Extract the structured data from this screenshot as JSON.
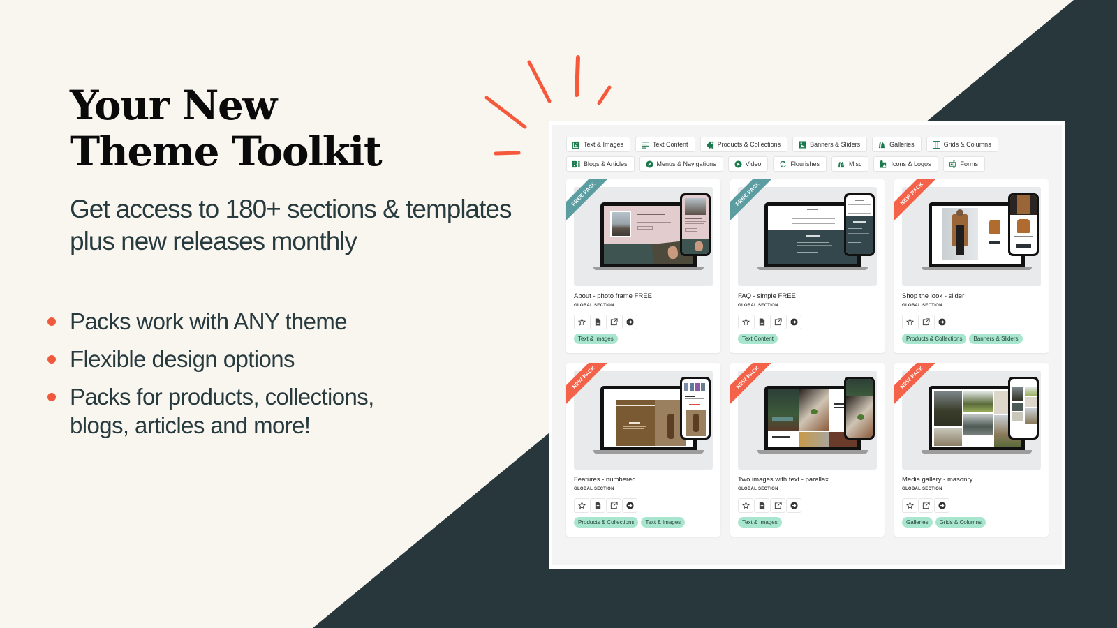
{
  "colors": {
    "background": "#f9f5ef",
    "dark": "#27373b",
    "accent": "#f05a3c",
    "brand_green": "#1b7a4c",
    "tag_bg": "#a9e6cf",
    "free_ribbon": "#5b9da0",
    "new_ribbon": "#f5624a"
  },
  "hero": {
    "title_line1": "Your New",
    "title_line2": "Theme Toolkit",
    "subtitle": "Get access to 180+ sections & templates plus new releases monthly"
  },
  "bullets": [
    "Packs work with ANY theme",
    "Flexible design options",
    "Packs for products, collections, blogs, articles and more!"
  ],
  "filters": {
    "row1": [
      {
        "label": "Text & Images",
        "icon": "image-icon"
      },
      {
        "label": "Text Content",
        "icon": "text-lines-icon"
      },
      {
        "label": "Products & Collections",
        "icon": "tag-plus-icon"
      },
      {
        "label": "Banners & Sliders",
        "icon": "picture-icon"
      },
      {
        "label": "Galleries",
        "icon": "bags-icon"
      },
      {
        "label": "Grids & Columns",
        "icon": "columns-icon"
      }
    ],
    "row2": [
      {
        "label": "Blogs & Articles",
        "icon": "blog-icon"
      },
      {
        "label": "Menus & Navigations",
        "icon": "compass-icon"
      },
      {
        "label": "Video",
        "icon": "play-icon"
      },
      {
        "label": "Flourishes",
        "icon": "refresh-icon"
      },
      {
        "label": "Misc",
        "icon": "bags-icon"
      },
      {
        "label": "Icons & Logos",
        "icon": "shapes-icon"
      },
      {
        "label": "Forms",
        "icon": "form-icon"
      }
    ]
  },
  "cards": [
    {
      "title": "About - photo frame FREE",
      "subtitle": "GLOBAL SECTION",
      "ribbon": "FREE PACK",
      "ribbon_type": "free",
      "has_doc": true,
      "tags": [
        "Text & Images"
      ]
    },
    {
      "title": "FAQ - simple FREE",
      "subtitle": "GLOBAL SECTION",
      "ribbon": "FREE PACK",
      "ribbon_type": "free",
      "has_doc": true,
      "tags": [
        "Text Content"
      ]
    },
    {
      "title": "Shop the look - slider",
      "subtitle": "GLOBAL SECTION",
      "ribbon": "NEW PACK",
      "ribbon_type": "new",
      "has_doc": false,
      "tags": [
        "Products & Collections",
        "Banners & Sliders"
      ]
    },
    {
      "title": "Features - numbered",
      "subtitle": "GLOBAL SECTION",
      "ribbon": "NEW PACK",
      "ribbon_type": "new",
      "has_doc": true,
      "tags": [
        "Products & Collections",
        "Text & Images"
      ]
    },
    {
      "title": "Two images with text - parallax",
      "subtitle": "GLOBAL SECTION",
      "ribbon": "NEW PACK",
      "ribbon_type": "new",
      "has_doc": true,
      "tags": [
        "Text & Images"
      ]
    },
    {
      "title": "Media gallery - masonry",
      "subtitle": "GLOBAL SECTION",
      "ribbon": "NEW PACK",
      "ribbon_type": "new",
      "has_doc": false,
      "tags": [
        "Galleries",
        "Grids & Columns"
      ]
    }
  ]
}
